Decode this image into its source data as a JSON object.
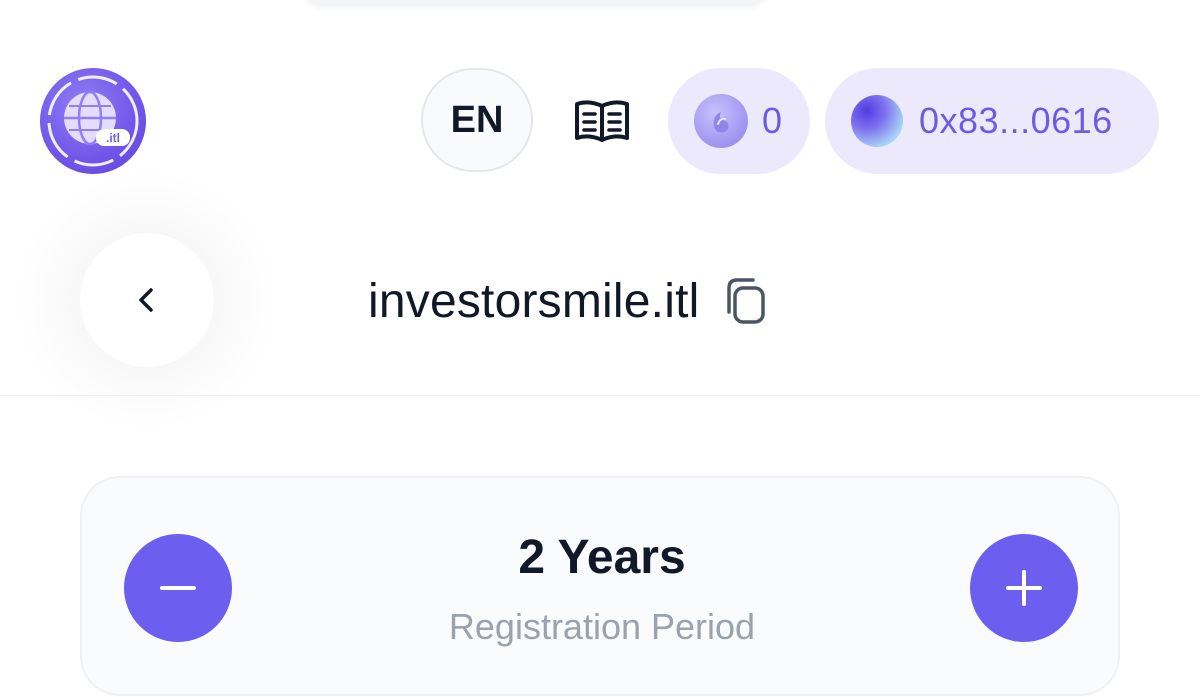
{
  "header": {
    "language": "EN",
    "points_count": "0",
    "wallet_address": "0x83...0616",
    "logo_text": ".itl"
  },
  "domain": {
    "name": "investorsmile.itl"
  },
  "registration": {
    "value": "2 Years",
    "label": "Registration Period"
  },
  "icons": {
    "logo": "globe-logo-icon",
    "docs": "book-open-icon",
    "points": "token-icon",
    "wallet": "wallet-avatar-icon",
    "back": "chevron-left-icon",
    "copy": "copy-icon",
    "minus": "minus-icon",
    "plus": "plus-icon"
  },
  "colors": {
    "accent": "#6c5fef",
    "pill_bg": "#ece9fc",
    "accent_text": "#6d5ce0",
    "muted_text": "#9aa2ae"
  }
}
